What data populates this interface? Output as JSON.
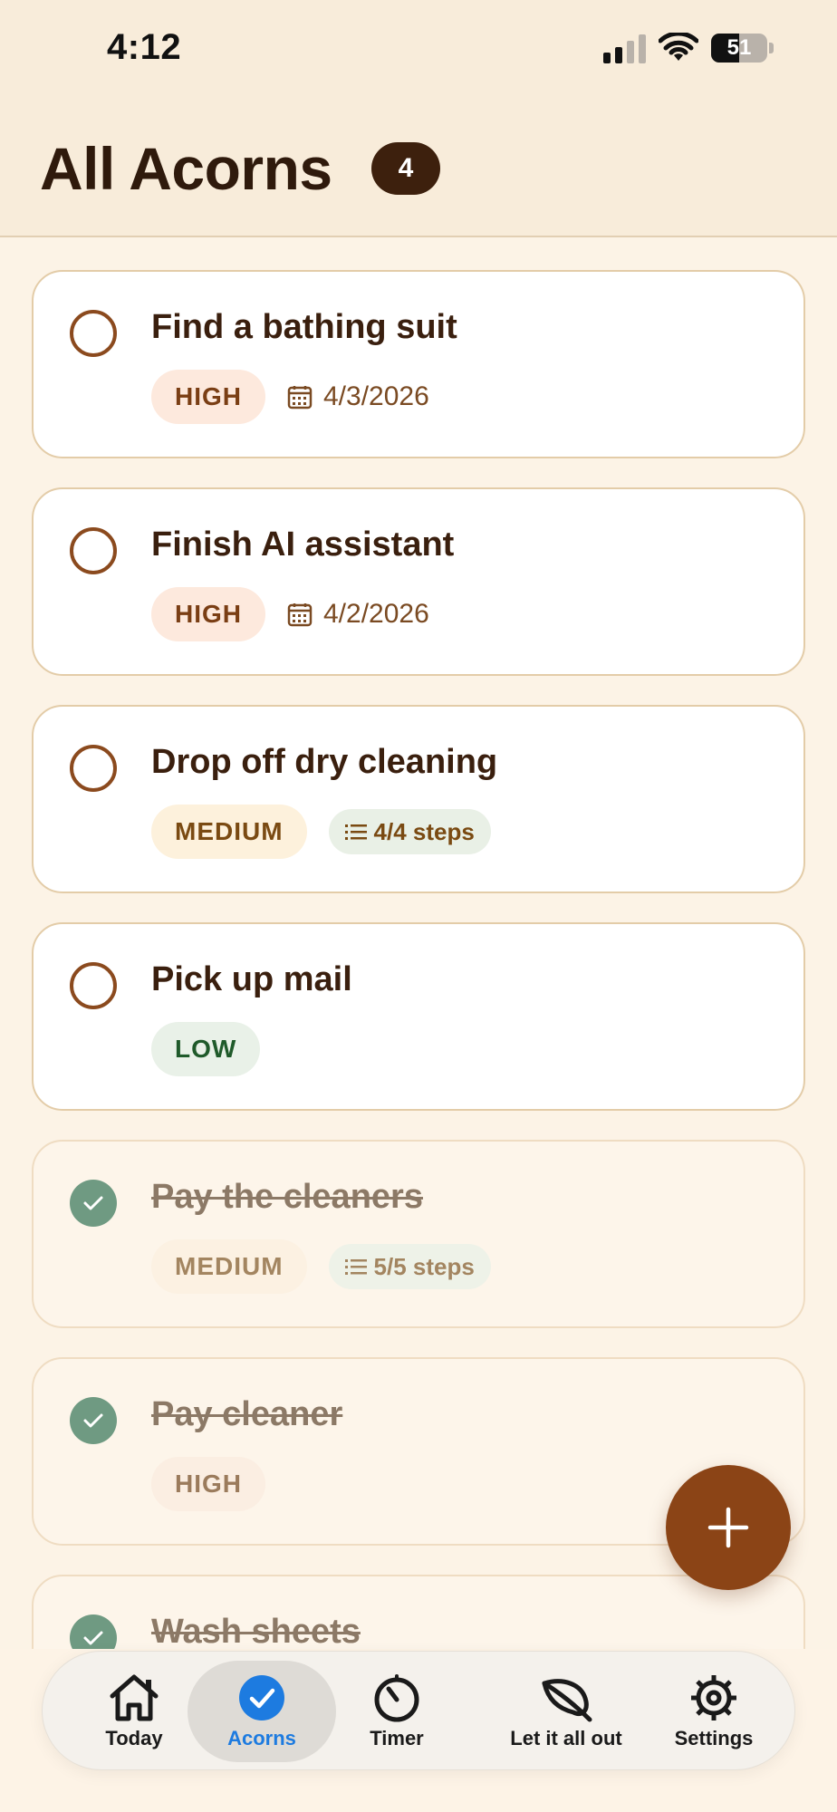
{
  "status_bar": {
    "time": "4:12",
    "battery": "51"
  },
  "header": {
    "title": "All Acorns",
    "count": "4"
  },
  "tasks": [
    {
      "title": "Find a bathing suit",
      "priority": "HIGH",
      "priority_level": "high",
      "date": "4/3/2026",
      "completed": false
    },
    {
      "title": "Finish AI assistant",
      "priority": "HIGH",
      "priority_level": "high",
      "date": "4/2/2026",
      "completed": false
    },
    {
      "title": "Drop off dry cleaning",
      "priority": "MEDIUM",
      "priority_level": "medium",
      "steps": "4/4 steps",
      "completed": false
    },
    {
      "title": "Pick up mail",
      "priority": "LOW",
      "priority_level": "low",
      "completed": false
    },
    {
      "title": "Pay the cleaners",
      "priority": "MEDIUM",
      "priority_level": "medium",
      "steps": "5/5 steps",
      "completed": true
    },
    {
      "title": "Pay cleaner",
      "priority": "HIGH",
      "priority_level": "high",
      "completed": true
    },
    {
      "title": "Wash sheets",
      "completed": true
    }
  ],
  "tabs": [
    {
      "label": "Today",
      "icon": "home-icon",
      "active": false
    },
    {
      "label": "Acorns",
      "icon": "checkmark-circle-icon",
      "active": true
    },
    {
      "label": "Timer",
      "icon": "timer-icon",
      "active": false
    },
    {
      "label": "Let it all out",
      "icon": "leaf-icon",
      "active": false
    },
    {
      "label": "Settings",
      "icon": "gear-icon",
      "active": false
    }
  ],
  "colors": {
    "background": "#fcf3e6",
    "accent": "#8b4416",
    "done_check": "#6f9a82",
    "active_tab": "#1d7be0"
  }
}
